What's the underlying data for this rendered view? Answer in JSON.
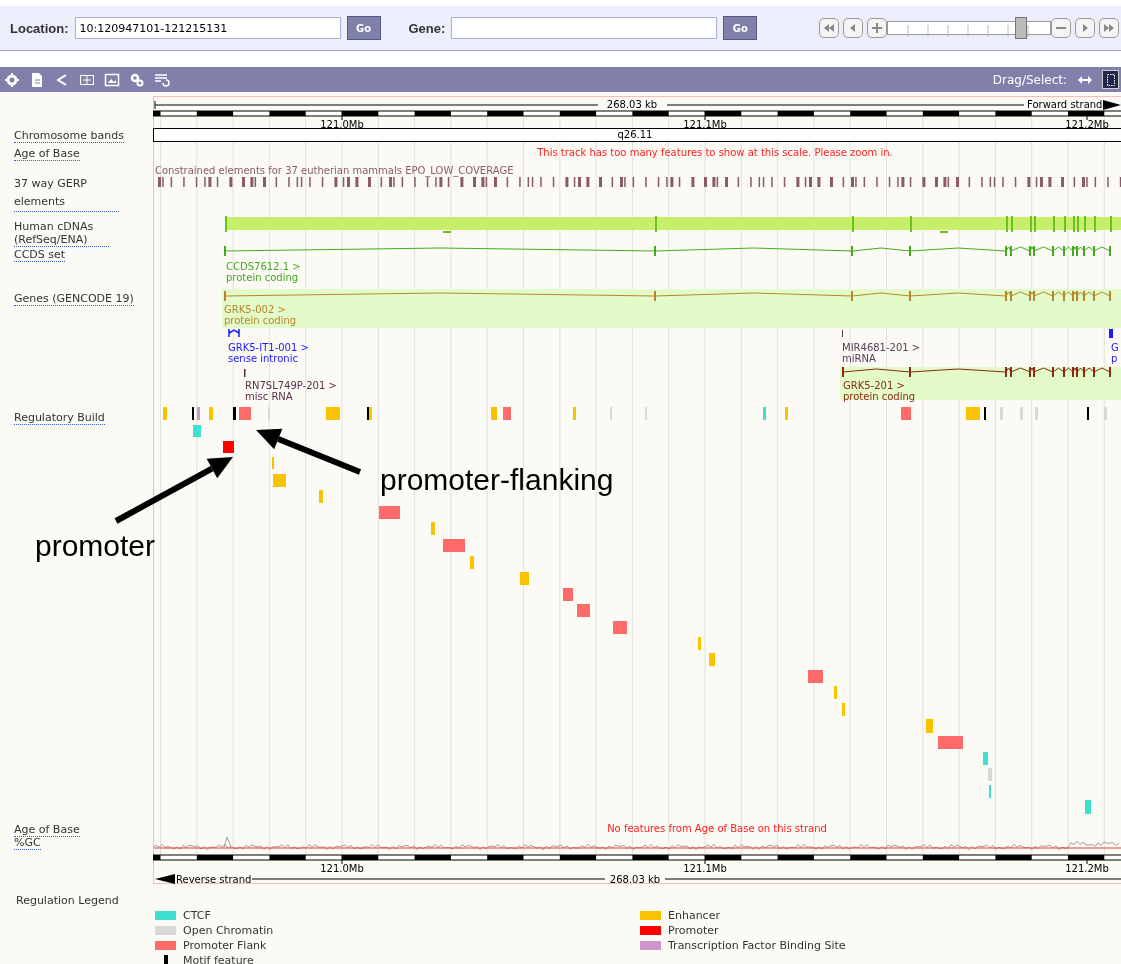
{
  "search_bar": {
    "location": {
      "label": "Location:",
      "value": "10:120947101-121215131",
      "button": "Go"
    },
    "gene": {
      "label": "Gene:",
      "button": "Go"
    },
    "zoom_slider": {
      "level": 0.82
    }
  },
  "toolbar": {
    "drag_select_label": "Drag/Select:",
    "modes": [
      {
        "selected": false
      },
      {
        "selected": true
      }
    ]
  },
  "scale_top": {
    "length": "268.03 kb",
    "strand": "Forward strand",
    "ticks": [
      "121.0Mb",
      "121.1Mb",
      "121.2Mb"
    ]
  },
  "tracks": [
    {
      "label": "Chromosome bands"
    },
    {
      "label": "Age of Base"
    },
    {
      "label": "37 way GERP elements"
    },
    {
      "label": "Human cDNAs (RefSeq/ENA)"
    },
    {
      "label": "CCDS set"
    },
    {
      "label": "Genes (GENCODE 19)"
    },
    {
      "label": "Regulatory Build"
    },
    {
      "label": "Age of Base"
    },
    {
      "label": "%GC"
    }
  ],
  "band": "q26.11",
  "age_message": "This track has too many features to show at this scale. Please zoom in.",
  "gerp_title": "Constrained elements for 37 eutherian mammals EPO_LOW_COVERAGE",
  "features": [
    {
      "name": "CCDS7612.1 >",
      "biotype": "protein coding",
      "color": "#44aa22"
    },
    {
      "name": "GRK5-002 >",
      "biotype": "protein coding",
      "color": "#b8862b"
    },
    {
      "name": "GRK5-IT1-001 >",
      "biotype": "sense intronic",
      "color": "#1a1aff"
    },
    {
      "name": "RN7SL749P-201 >",
      "biotype": "misc RNA",
      "color": "#5a2e4a"
    },
    {
      "name": "MIR4681-201 >",
      "biotype": "miRNA",
      "color": "#5a3a5a"
    },
    {
      "name": "GRK5-201 >",
      "biotype": "protein coding",
      "color": "#8b2a10"
    },
    {
      "name": "G",
      "biotype": "p",
      "color": "#1a1aff"
    }
  ],
  "bottom_message": "No features from Age of Base on this strand",
  "scale_bottom": {
    "strand": "Reverse strand",
    "length": "268.03 kb",
    "ticks": [
      "121.0Mb",
      "121.1Mb",
      "121.2Mb"
    ]
  },
  "legend": {
    "title": "Regulation Legend",
    "items": [
      {
        "label": "CTCF",
        "color": "#40e0d0",
        "kind": "swatch"
      },
      {
        "label": "Enhancer",
        "color": "#f8c300",
        "kind": "swatch"
      },
      {
        "label": "Open Chromatin",
        "color": "#d8d8d8",
        "kind": "swatch"
      },
      {
        "label": "Promoter",
        "color": "#ff0000",
        "kind": "swatch"
      },
      {
        "label": "Promoter Flank",
        "color": "#ff6a6a",
        "kind": "swatch"
      },
      {
        "label": "Transcription Factor Binding Site",
        "color": "#cd96cd",
        "kind": "swatch"
      },
      {
        "label": "Motif feature",
        "color": "#000000",
        "kind": "bar"
      }
    ]
  },
  "annotations": [
    {
      "text": "promoter-flanking"
    },
    {
      "text": "promoter"
    }
  ]
}
